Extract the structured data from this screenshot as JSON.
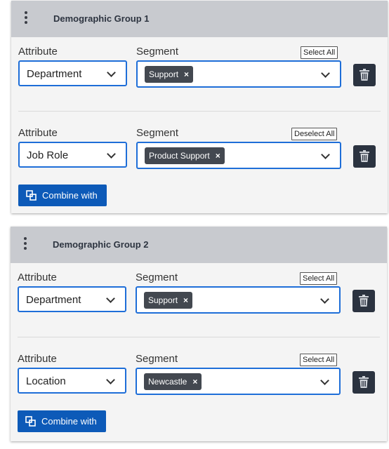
{
  "groups": [
    {
      "title": "Demographic Group 1",
      "rows": [
        {
          "attribute_label": "Attribute",
          "segment_label": "Segment",
          "select_toggle": "Select All",
          "attribute_value": "Department",
          "chip": "Support"
        },
        {
          "attribute_label": "Attribute",
          "segment_label": "Segment",
          "select_toggle": "Deselect All",
          "attribute_value": "Job Role",
          "chip": "Product Support"
        }
      ],
      "combine_label": "Combine with"
    },
    {
      "title": "Demographic Group 2",
      "rows": [
        {
          "attribute_label": "Attribute",
          "segment_label": "Segment",
          "select_toggle": "Select All",
          "attribute_value": "Department",
          "chip": "Support"
        },
        {
          "attribute_label": "Attribute",
          "segment_label": "Segment",
          "select_toggle": "Select All",
          "attribute_value": "Location",
          "chip": "Newcastle"
        }
      ],
      "combine_label": "Combine with"
    }
  ],
  "chip_remove_symbol": "×",
  "icons": {
    "menu": "kebab-menu-icon",
    "remove": "close-icon",
    "delete": "trash-icon",
    "expand": "chevron-down-icon",
    "combine": "combine-icon"
  },
  "colors": {
    "header_bg": "#c8cacf",
    "focus_border": "#1e6ed8",
    "chip_bg": "#434850",
    "delete_bg": "#2b3340",
    "combine_bg": "#0d5ab8"
  }
}
